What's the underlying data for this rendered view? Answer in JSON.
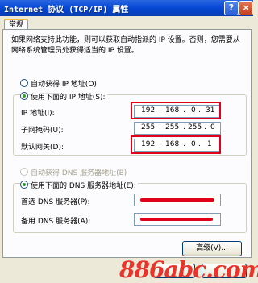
{
  "window": {
    "title": "Internet 协议 (TCP/IP) 属性"
  },
  "titlebar": {
    "help_icon": "?",
    "close_icon": "×"
  },
  "tabs": [
    {
      "label": "常规"
    }
  ],
  "description": "如果网络支持此功能，则可以获取自动指派的 IP 设置。否则，您需要从网络系统管理员处获得适当的 IP 设置。",
  "ip_section": {
    "auto_label": "自动获得 IP 地址(O)",
    "manual_label": "使用下面的 IP 地址(S):",
    "selected": "manual",
    "fields": {
      "ip": {
        "label": "IP 地址(I):",
        "value": [
          "192",
          "168",
          "0",
          "31"
        ]
      },
      "mask": {
        "label": "子网掩码(U):",
        "value": [
          "255",
          "255",
          "255",
          "0"
        ]
      },
      "gateway": {
        "label": "默认网关(D):",
        "value": [
          "192",
          "168",
          "0",
          "1"
        ]
      }
    }
  },
  "dns_section": {
    "auto_label": "自动获得 DNS 服务器地址(B)",
    "manual_label": "使用下面的 DNS 服务器地址(E):",
    "selected": "manual",
    "fields": {
      "preferred": {
        "label": "首选 DNS 服务器(P):",
        "value": ""
      },
      "alternate": {
        "label": "备用 DNS 服务器(A):",
        "value": ""
      }
    }
  },
  "buttons": {
    "advanced": "高级(V)..."
  },
  "watermark": "886abc.com",
  "colors": {
    "annotation": "#e0001b",
    "title_bar": "#0a4dd8"
  }
}
